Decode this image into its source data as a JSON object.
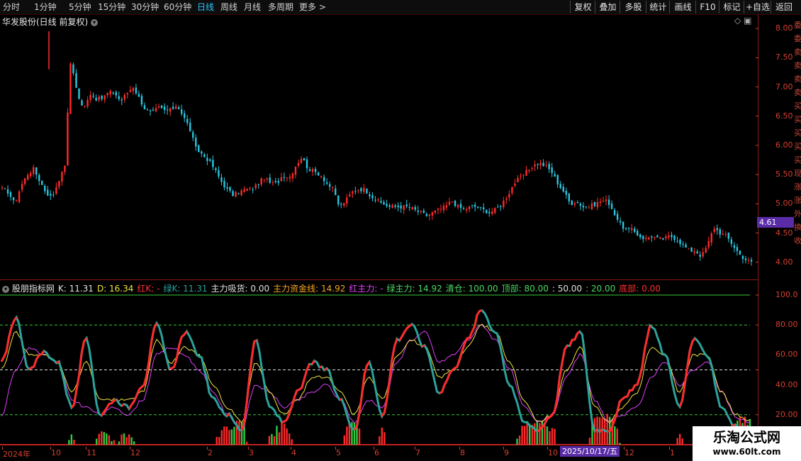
{
  "toolbar": {
    "periods": [
      "分时",
      "1分钟",
      "5分钟",
      "15分钟",
      "30分钟",
      "60分钟",
      "日线",
      "周线",
      "月线",
      "多周期"
    ],
    "active_period": "日线",
    "more_label": "更多",
    "right_buttons": [
      "复权",
      "叠加",
      "多股",
      "统计",
      "画线",
      "F10",
      "标记",
      "+自选",
      "返回"
    ]
  },
  "stock": {
    "title": "华发股份(日线 前复权)",
    "last_price": "4.61"
  },
  "indicator_legend": [
    {
      "text": "股朋指标网",
      "color": "#e0e0e0"
    },
    {
      "text": "K: 11.31",
      "color": "#e0e0e0"
    },
    {
      "text": "D: 16.34",
      "color": "#f0e442"
    },
    {
      "text": "红K: -",
      "color": "#ff3030"
    },
    {
      "text": "绿K: 11.31",
      "color": "#2aa39b"
    },
    {
      "text": "主力吸货: 0.00",
      "color": "#e0e0e0"
    },
    {
      "text": "主力资金线: 14.92",
      "color": "#f5a623"
    },
    {
      "text": "红主力: -",
      "color": "#e040fb"
    },
    {
      "text": "绿主力: 14.92",
      "color": "#4cd964"
    },
    {
      "text": "清仓: 100.00",
      "color": "#4cd964"
    },
    {
      "text": "顶部: 80.00",
      "color": "#4cd964"
    },
    {
      "text": ": 50.00",
      "color": "#e0e0e0"
    },
    {
      "text": ": 20.00",
      "color": "#4cd964"
    },
    {
      "text": "底部: 0.00",
      "color": "#ff3030"
    }
  ],
  "price_axis": [
    "8.00",
    "7.50",
    "7.00",
    "6.50",
    "6.00",
    "5.50",
    "5.00",
    "4.50",
    "4.00"
  ],
  "indicator_axis": [
    "100.0",
    "80.00",
    "60.00",
    "40.00",
    "20.00"
  ],
  "time_axis": [
    "2024年",
    "10",
    "11",
    "12",
    "2",
    "3",
    "4",
    "5",
    "6",
    "7",
    "8",
    "9",
    "10",
    "12",
    "1"
  ],
  "cursor_date": "2025/10/17/五",
  "right_strip_chars": [
    "委",
    "委",
    "卖",
    "卖",
    "卖",
    "卖",
    "买",
    "买",
    "买",
    "买",
    "买",
    "现",
    "涨",
    "涨",
    "外",
    "换",
    "收"
  ],
  "watermark": {
    "title": "乐淘公式网",
    "url": "www.60lt.com"
  },
  "colors": {
    "up": "#ff2a2a",
    "down": "#28c7e0",
    "k_line": "#2aa39b",
    "d_line": "#f0e442",
    "main_line": "#e040fb",
    "main_fund": "#f5a623",
    "volume_green": "#2ecc40",
    "axis": "#d6402e"
  },
  "chart_data": [
    {
      "type": "candlestick",
      "title": "华发股份(日线 前复权)",
      "y_axis_ticks": [
        8.0,
        7.5,
        7.0,
        6.5,
        6.0,
        5.5,
        5.0,
        4.5,
        4.0
      ],
      "ylim": [
        3.9,
        8.05
      ],
      "last_price": 4.61,
      "close_path": [
        5.25,
        5.2,
        5.0,
        5.3,
        5.5,
        5.6,
        5.4,
        5.2,
        5.1,
        5.4,
        5.6,
        7.5,
        6.9,
        6.6,
        6.9,
        6.8,
        6.8,
        6.9,
        6.9,
        6.75,
        6.9,
        7.0,
        6.8,
        6.6,
        6.55,
        6.65,
        6.6,
        6.6,
        6.7,
        6.5,
        6.3,
        5.95,
        5.85,
        5.75,
        5.6,
        5.4,
        5.25,
        5.15,
        5.2,
        5.25,
        5.25,
        5.35,
        5.45,
        5.35,
        5.35,
        5.5,
        5.45,
        5.65,
        5.8,
        5.6,
        5.55,
        5.5,
        5.35,
        5.25,
        4.95,
        5.05,
        5.2,
        5.25,
        5.25,
        5.15,
        5.05,
        5.0,
        4.95,
        4.95,
        4.95,
        4.95,
        4.9,
        4.85,
        4.8,
        4.85,
        4.9,
        4.95,
        5.05,
        4.95,
        4.9,
        4.95,
        4.95,
        4.9,
        4.85,
        4.9,
        5.0,
        5.15,
        5.35,
        5.45,
        5.55,
        5.65,
        5.7,
        5.65,
        5.55,
        5.35,
        5.2,
        5.0,
        5.05,
        4.95,
        4.95,
        5.0,
        5.05,
        5.05,
        4.85,
        4.65,
        4.55,
        4.55,
        4.45,
        4.4,
        4.45,
        4.4,
        4.4,
        4.45,
        4.4,
        4.3,
        4.2,
        4.2,
        4.1,
        4.3,
        4.6,
        4.5,
        4.45,
        4.3,
        4.15,
        4.05,
        4.0
      ]
    },
    {
      "type": "line",
      "title": "股朋指标网",
      "y_axis_ticks": [
        100,
        80,
        50,
        20
      ],
      "ylim": [
        0,
        100
      ],
      "guide_lines": {
        "清仓": 100,
        "顶部": 80,
        "中线": 50,
        "买线": 20,
        "底部": 0
      },
      "series": [
        {
          "name": "K",
          "values": [
            55,
            85,
            50,
            62,
            55,
            25,
            70,
            20,
            30,
            25,
            40,
            80,
            50,
            75,
            60,
            30,
            20,
            10,
            70,
            25,
            15,
            35,
            55,
            50,
            30,
            10,
            55,
            20,
            70,
            80,
            65,
            35,
            50,
            70,
            90,
            75,
            40,
            15,
            10,
            20,
            65,
            75,
            10,
            10,
            30,
            40,
            80,
            60,
            25,
            70,
            60,
            25,
            12,
            11.31
          ]
        },
        {
          "name": "D",
          "values": [
            50,
            75,
            60,
            60,
            55,
            35,
            55,
            30,
            30,
            30,
            35,
            70,
            55,
            65,
            60,
            40,
            25,
            15,
            55,
            35,
            20,
            30,
            45,
            45,
            35,
            20,
            45,
            30,
            60,
            70,
            65,
            45,
            50,
            65,
            80,
            75,
            55,
            30,
            15,
            20,
            50,
            65,
            25,
            15,
            25,
            35,
            65,
            60,
            35,
            60,
            60,
            35,
            20,
            16.34
          ]
        },
        {
          "name": "主力资金线",
          "values": [
            20,
            50,
            65,
            60,
            55,
            30,
            25,
            20,
            25,
            20,
            30,
            60,
            65,
            60,
            50,
            35,
            20,
            10,
            40,
            35,
            25,
            30,
            35,
            40,
            30,
            15,
            30,
            25,
            55,
            70,
            75,
            55,
            60,
            70,
            80,
            70,
            50,
            25,
            15,
            20,
            45,
            60,
            30,
            15,
            20,
            25,
            45,
            55,
            40,
            50,
            55,
            35,
            18,
            14.92
          ]
        }
      ]
    }
  ]
}
